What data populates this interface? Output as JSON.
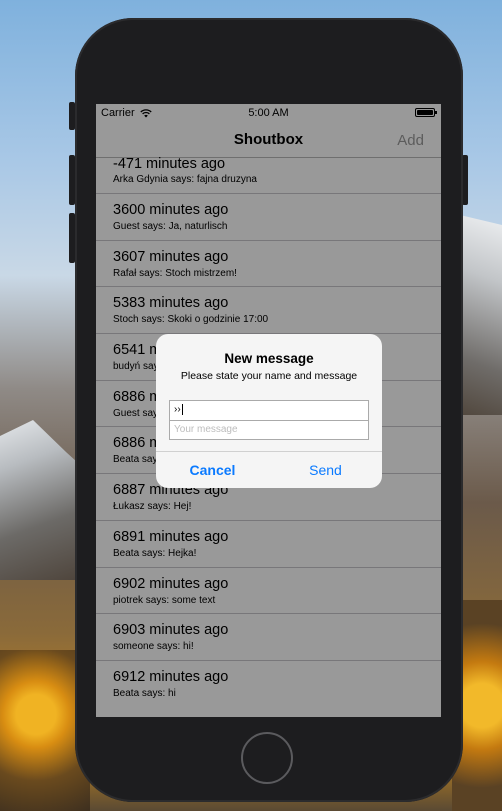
{
  "status_bar": {
    "carrier": "Carrier",
    "time": "5:00 AM"
  },
  "nav": {
    "title": "Shoutbox",
    "add_label": "Add"
  },
  "messages": [
    {
      "time": "-471 minutes ago",
      "text": "Arka Gdynia says: fajna druzyna"
    },
    {
      "time": "3600 minutes ago",
      "text": "Guest says: Ja, naturlisch"
    },
    {
      "time": "3607 minutes ago",
      "text": "Rafał says: Stoch mistrzem!"
    },
    {
      "time": "5383 minutes ago",
      "text": "Stoch says: Skoki o godzinie 17:00"
    },
    {
      "time": "6541 minutes ago",
      "text": "budyń says"
    },
    {
      "time": "6886 minutes ago",
      "text": "Guest says"
    },
    {
      "time": "6886 minutes ago",
      "text": "Beata says"
    },
    {
      "time": "6887 minutes ago",
      "text": "Łukasz says: Hej!"
    },
    {
      "time": "6891 minutes ago",
      "text": "Beata says: Hejka!"
    },
    {
      "time": "6902 minutes ago",
      "text": "piotrek says: some text"
    },
    {
      "time": "6903 minutes ago",
      "text": "someone says: hi!"
    },
    {
      "time": "6912 minutes ago",
      "text": "Beata says: hi"
    }
  ],
  "alert": {
    "title": "New message",
    "message": "Please state your name and message",
    "name_value": "››",
    "message_placeholder": "Your message",
    "cancel_label": "Cancel",
    "send_label": "Send"
  },
  "colors": {
    "accent": "#0a7aff",
    "dim_overlay": "rgba(0,0,0,0.4)",
    "phone_body": "#1d1d1f"
  }
}
